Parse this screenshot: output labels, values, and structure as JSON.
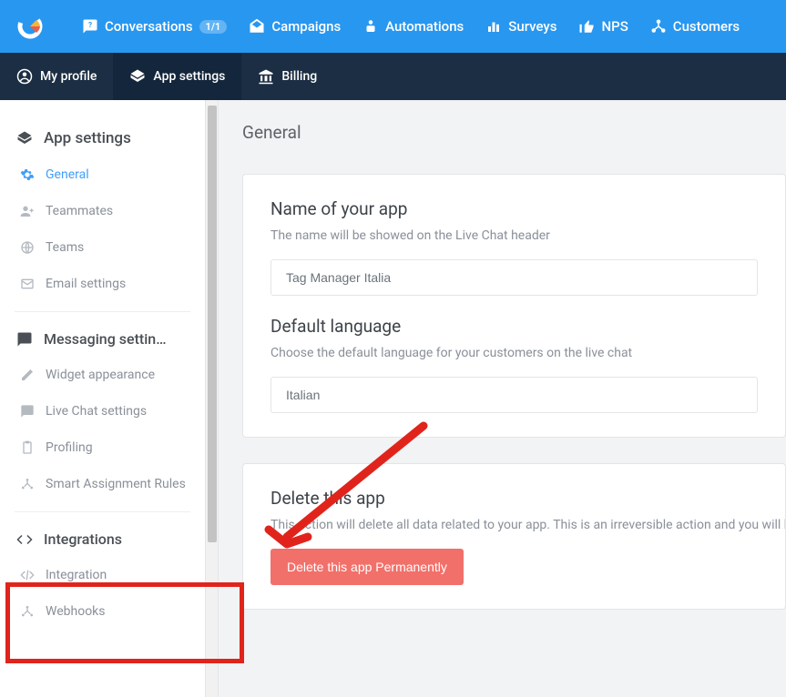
{
  "topnav": {
    "items": [
      {
        "label": "Conversations",
        "badge": "1/1"
      },
      {
        "label": "Campaigns"
      },
      {
        "label": "Automations"
      },
      {
        "label": "Surveys"
      },
      {
        "label": "NPS"
      },
      {
        "label": "Customers"
      }
    ]
  },
  "subnav": {
    "items": [
      {
        "label": "My profile"
      },
      {
        "label": "App settings"
      },
      {
        "label": "Billing"
      }
    ]
  },
  "sidebar": {
    "section1_title": "App settings",
    "items1": [
      {
        "label": "General",
        "active": true
      },
      {
        "label": "Teammates"
      },
      {
        "label": "Teams"
      },
      {
        "label": "Email settings"
      }
    ],
    "section2_title": "Messaging settin…",
    "items2": [
      {
        "label": "Widget appearance"
      },
      {
        "label": "Live Chat settings"
      },
      {
        "label": "Profiling"
      },
      {
        "label": "Smart Assignment Rules"
      }
    ],
    "section3_title": "Integrations",
    "items3": [
      {
        "label": "Integration"
      },
      {
        "label": "Webhooks"
      }
    ]
  },
  "main": {
    "title": "General",
    "name_section": {
      "heading": "Name of your app",
      "sub": "The name will be showed on the Live Chat header",
      "value": "Tag Manager Italia"
    },
    "lang_section": {
      "heading": "Default language",
      "sub": "Choose the default language for your customers on the live chat",
      "value": "Italian"
    },
    "delete_section": {
      "heading": "Delete this app",
      "sub": "This action will delete all data related to your app. This is an irreversible action and you will be logged out automatically. You can create another app by registering again.",
      "button": "Delete this app Permanently"
    }
  }
}
